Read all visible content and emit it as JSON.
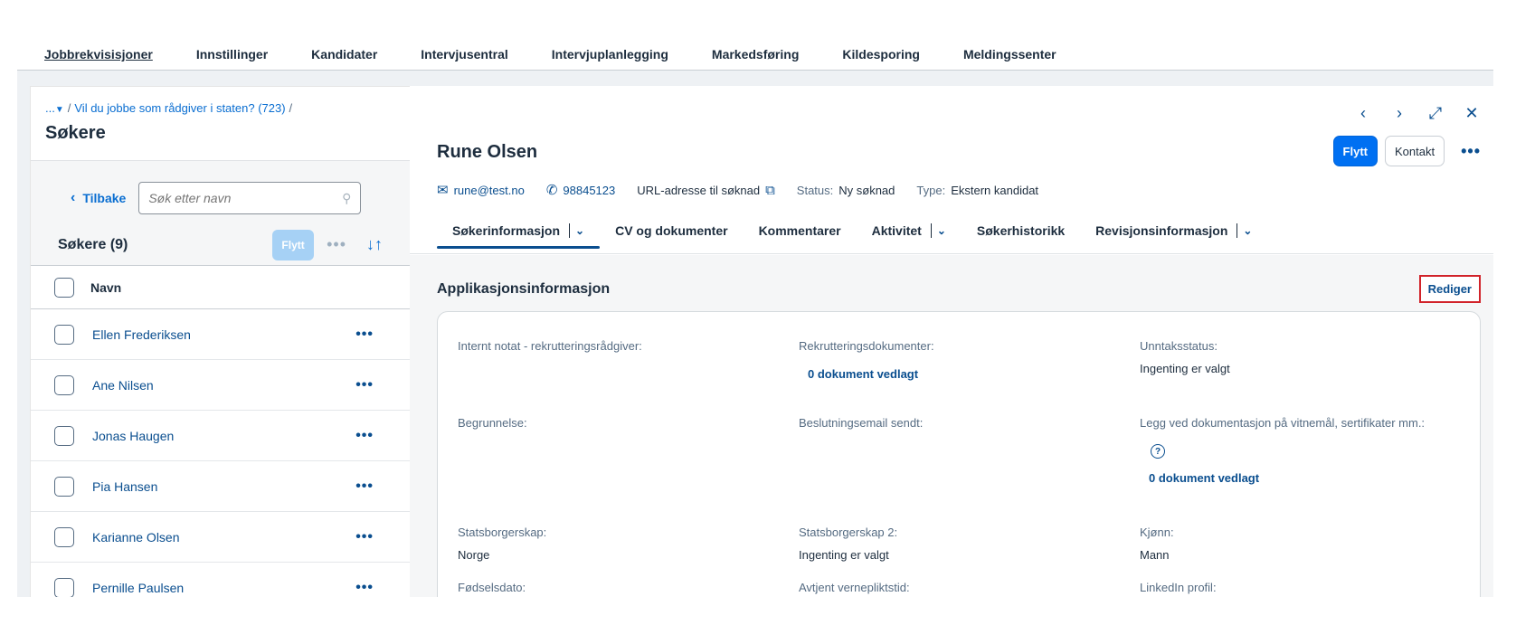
{
  "topnav": [
    "Jobbrekvisisjoner",
    "Innstillinger",
    "Kandidater",
    "Intervjusentral",
    "Intervjuplanlegging",
    "Markedsføring",
    "Kildesporing",
    "Meldingssenter"
  ],
  "left": {
    "breadcrumb_ellipsis": "...",
    "breadcrumb": "Vil du jobbe som rådgiver i staten? (723)",
    "breadcrumb_sep": "/",
    "title": "Søkere",
    "back_label": "Tilbake",
    "search_placeholder": "Søk etter navn",
    "list_count": "Søkere (9)",
    "flytt_label": "Flytt",
    "col_name": "Navn",
    "rows": [
      "Ellen Frederiksen",
      "Ane Nilsen",
      "Jonas Haugen",
      "Pia Hansen",
      "Karianne Olsen",
      "Pernille Paulsen"
    ]
  },
  "right": {
    "person": "Rune Olsen",
    "btn_flytt": "Flytt",
    "btn_kontakt": "Kontakt",
    "email": "rune@test.no",
    "phone": "98845123",
    "url_label": "URL-adresse til søknad",
    "status_label": "Status:",
    "status_value": "Ny søknad",
    "type_label": "Type:",
    "type_value": "Ekstern kandidat",
    "tabs": [
      "Søkerinformasjon",
      "CV og dokumenter",
      "Kommentarer",
      "Aktivitet",
      "Søkerhistorikk",
      "Revisjonsinformasjon"
    ],
    "section_title": "Applikasjonsinformasjon",
    "edit_label": "Rediger",
    "fields": {
      "internt_notat": "Internt notat - rekrutteringsrådgiver:",
      "rekrutteringsdok": "Rekrutteringsdokumenter:",
      "rekrutteringsdok_value": "0 dokument vedlagt",
      "unntaksstatus": "Unntaksstatus:",
      "unntaksstatus_value": "Ingenting er valgt",
      "begrunnelse": "Begrunnelse:",
      "beslutningsemail": "Beslutningsemail sendt:",
      "legg_ved": "Legg ved dokumentasjon på vitnemål, sertifikater mm.:",
      "legg_ved_value": "0 dokument vedlagt",
      "statsborgerskap": "Statsborgerskap:",
      "statsborgerskap_value": "Norge",
      "statsborgerskap2": "Statsborgerskap 2:",
      "statsborgerskap2_value": "Ingenting er valgt",
      "kjonn": "Kjønn:",
      "kjonn_value": "Mann",
      "fodselsdato": "Fødselsdato:",
      "verneplikt": "Avtjent vernepliktstid:",
      "linkedin": "LinkedIn profil:"
    }
  }
}
